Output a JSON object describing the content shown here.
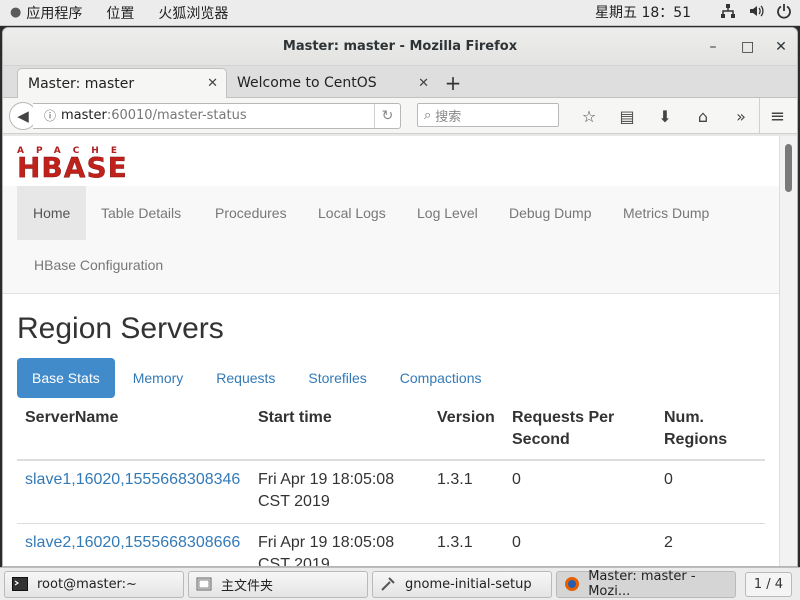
{
  "topbar": {
    "apps_menu": "应用程序",
    "places_menu": "位置",
    "browser_launcher": "火狐浏览器",
    "clock": "星期五 18：51"
  },
  "window": {
    "title": "Master: master - Mozilla Firefox"
  },
  "tabs": [
    {
      "label": "Master: master"
    },
    {
      "label": "Welcome to CentOS"
    }
  ],
  "navbar": {
    "url_host": "master",
    "url_path": ":60010/master-status",
    "search_placeholder": "搜索"
  },
  "logo": {
    "apache": "APACHE",
    "hbase": "HBASE"
  },
  "sitenav": {
    "items": [
      "Home",
      "Table Details",
      "Procedures",
      "Local Logs",
      "Log Level",
      "Debug Dump",
      "Metrics Dump",
      "HBase Configuration"
    ]
  },
  "page": {
    "section_title": "Region Servers",
    "subtabs": [
      "Base Stats",
      "Memory",
      "Requests",
      "Storefiles",
      "Compactions"
    ],
    "table": {
      "headers": [
        "ServerName",
        "Start time",
        "Version",
        "Requests Per Second",
        "Num. Regions"
      ],
      "rows": [
        [
          "slave1,16020,1555668308346",
          "Fri Apr 19 18:05:08 CST 2019",
          "1.3.1",
          "0",
          "0"
        ],
        [
          "slave2,16020,1555668308666",
          "Fri Apr 19 18:05:08 CST 2019",
          "1.3.1",
          "0",
          "2"
        ]
      ]
    }
  },
  "taskbar": {
    "tasks": [
      "root@master:~",
      "主文件夹",
      "gnome-initial-setup",
      "Master: master - Mozi..."
    ],
    "workspace": "1 / 4"
  },
  "colors": {
    "link": "#337ab7",
    "active_subtab": "#428bca",
    "hbase_red": "#c0211b"
  }
}
